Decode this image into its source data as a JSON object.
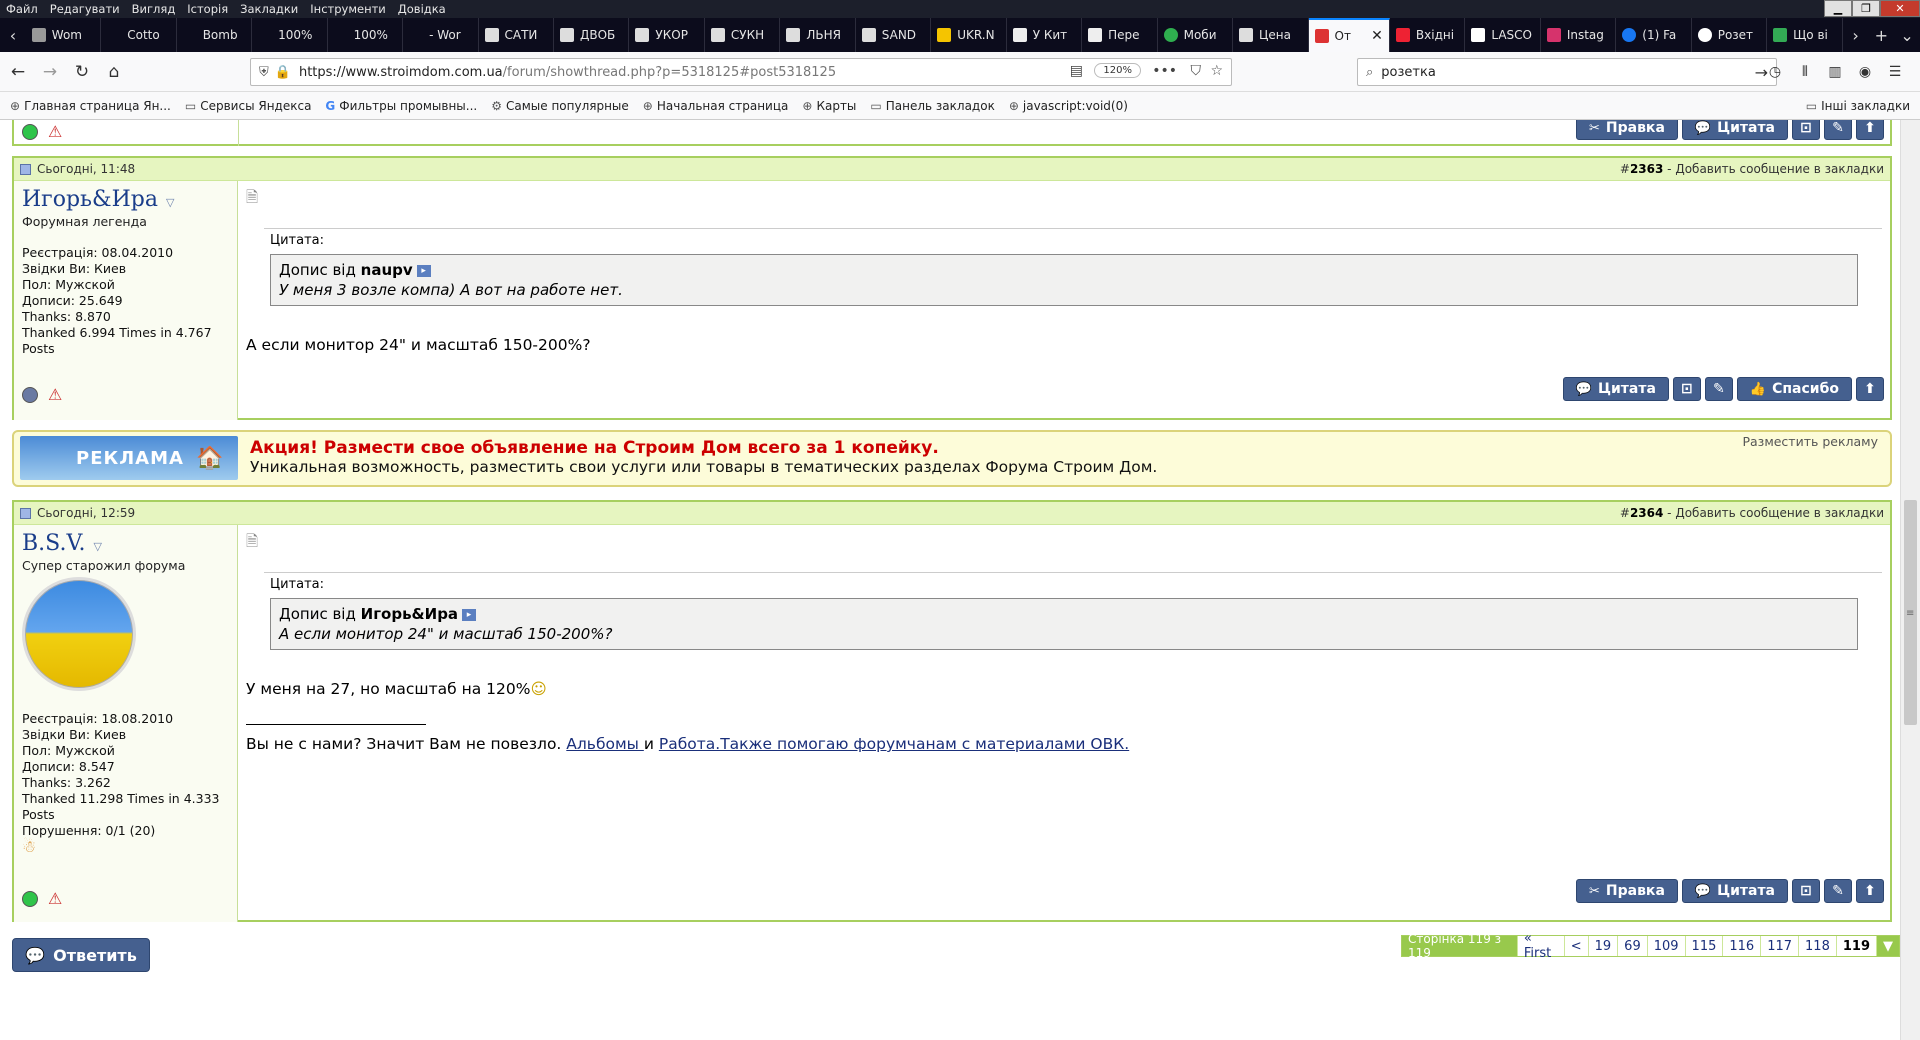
{
  "menu": [
    "Файл",
    "Редагувати",
    "Вигляд",
    "Історія",
    "Закладки",
    "Інструменти",
    "Довідка"
  ],
  "tabs": [
    {
      "label": "Wom"
    },
    {
      "label": "Cotto"
    },
    {
      "label": "Bomb"
    },
    {
      "label": "100%"
    },
    {
      "label": "100%"
    },
    {
      "label": "- Wor"
    },
    {
      "label": "САТИ"
    },
    {
      "label": "ДВОБ"
    },
    {
      "label": "УКОР"
    },
    {
      "label": "СУКН"
    },
    {
      "label": "ЛЬНЯ"
    },
    {
      "label": "SAND"
    },
    {
      "label": "UKR.N"
    },
    {
      "label": "У Кит"
    },
    {
      "label": "Пере"
    },
    {
      "label": "Моби"
    },
    {
      "label": "Цена"
    },
    {
      "label": "От"
    },
    {
      "label": "Вхідні"
    },
    {
      "label": "LASCO"
    },
    {
      "label": "Instag"
    },
    {
      "label": "(1) Fa"
    },
    {
      "label": "Розет"
    },
    {
      "label": "Що ві"
    }
  ],
  "nav": {
    "url_domain": "https://www.stroimdom.com.ua",
    "url_path": "/forum/showthread.php?p=5318125#post5318125",
    "zoom": "120%",
    "search": "розетка"
  },
  "bookmarks": [
    "Главная страница Ян...",
    "Сервисы Яндекса",
    "Фильтры промывны...",
    "Самые популярные",
    "Начальная страница",
    "Карты",
    "Панель закладок",
    "javascript:void(0)"
  ],
  "bookmarks_other": "Інші закладки",
  "post1": {
    "date": "Сьогодні, 11:48",
    "num_prefix": "#",
    "num": "2363",
    "bookmark_link": "Добавить сообщение в закладки",
    "username": "Игорь&Ира",
    "usertitle": "Форумная легенда",
    "info": [
      "Реєстрація: 08.04.2010",
      "Звідки Ви: Киев",
      "Пол: Мужской",
      "Дописи: 25.649",
      "Thanks: 8.870",
      "Thanked 6.994 Times in 4.767",
      "Posts"
    ],
    "quote_label": "Цитата:",
    "quote_from_prefix": "Допис від",
    "quote_author": "naupv",
    "quote_text": "У меня 3 возле компа) А вот на работе нет.",
    "message": "А если монитор 24\" и масштаб 150-200%?",
    "btn_quote": "Цитата",
    "btn_thanks": "Спасибо"
  },
  "ad": {
    "image_label": "РЕКЛАМА",
    "title": "Акция! Размести свое объявление на Строим Дом всего за 1 копейку.",
    "text": "Уникальная возможность, разместить свои услуги или товары в тематических разделах Форума Строим Дом.",
    "link": "Разместить рекламу"
  },
  "post2": {
    "date": "Сьогодні, 12:59",
    "num_prefix": "#",
    "num": "2364",
    "bookmark_link": "Добавить сообщение в закладки",
    "username": "B.S.V.",
    "usertitle": "Супер старожил форума",
    "info": [
      "Реєстрація: 18.08.2010",
      "Звідки Ви: Киев",
      "Пол: Мужской",
      "Дописи: 8.547",
      "Thanks: 3.262",
      "Thanked 11.298 Times in 4.333",
      "Posts",
      "Порушення: 0/1 (20)"
    ],
    "quote_label": "Цитата:",
    "quote_from_prefix": "Допис від",
    "quote_author": "Игорь&Ира",
    "quote_text": "А если монитор 24\" и масштаб 150-200%?",
    "message": "У меня на 27, но масштаб на 120%",
    "sig_text": "Вы не с нами? Значит Вам не повезло.",
    "sig_link1": "Альбомы ",
    "sig_and": " и ",
    "sig_link2": "Работа.Также помогаю форумчанам с материалами ОВК.",
    "btn_edit": "Правка",
    "btn_quote": "Цитата"
  },
  "top_btns": {
    "edit": "Правка",
    "quote": "Цитата"
  },
  "reply_btn": "Ответить",
  "pager": {
    "label": "Сторінка 119 з 119",
    "first": "« First",
    "prev": "<",
    "pages": [
      "19",
      "69",
      "109",
      "115",
      "116",
      "117",
      "118"
    ],
    "current": "119"
  },
  "colors": {
    "accent": "#45608f",
    "post_border": "#a7cf5f",
    "header_bg": "#e6f5c0",
    "ad_title": "#cc0000"
  }
}
